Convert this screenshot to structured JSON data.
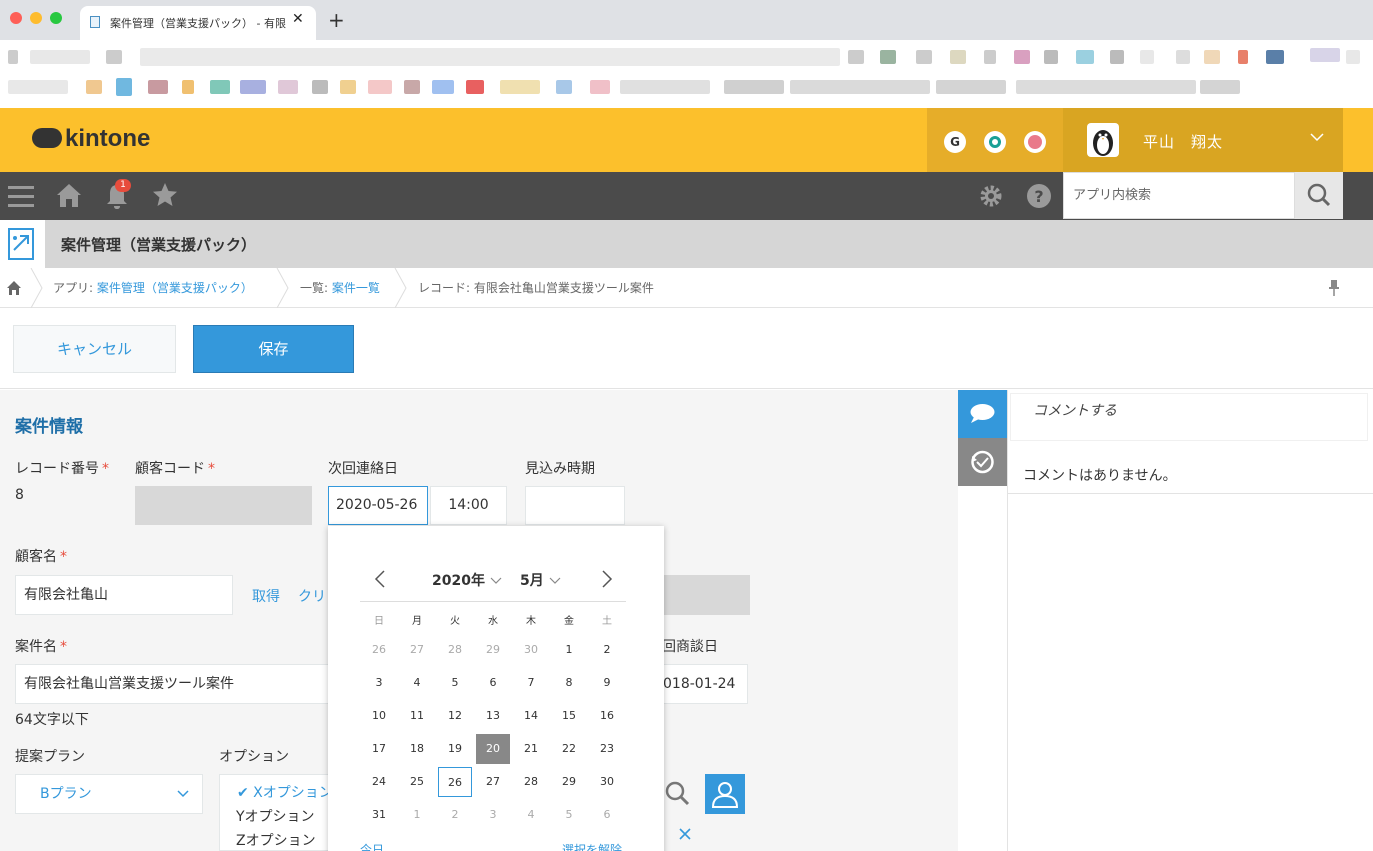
{
  "browser": {
    "tab_title": "案件管理（営業支援パック） - 有限",
    "tab_close": "✕",
    "new_tab": "+"
  },
  "header": {
    "logo_text": "kintone",
    "user_name": "平山　翔太",
    "icon_g": "G"
  },
  "navbar": {
    "notification_count": "1",
    "search_placeholder": "アプリ内検索"
  },
  "app": {
    "title": "案件管理（営業支援パック）"
  },
  "breadcrumb": {
    "app_prefix": "アプリ: ",
    "app_link": "案件管理（営業支援パック）",
    "list_prefix": "一覧: ",
    "list_link": "案件一覧",
    "record_prefix": "レコード: ",
    "record_name": "有限会社亀山営業支援ツール案件"
  },
  "toolbar": {
    "cancel_label": "キャンセル",
    "save_label": "保存"
  },
  "form": {
    "section_title": "案件情報",
    "record_number_label": "レコード番号",
    "record_number_value": "8",
    "customer_code_label": "顧客コード",
    "next_contact_label": "次回連絡日",
    "next_contact_date": "2020-05-26",
    "next_contact_time": "14:00",
    "expected_period_label": "見込み時期",
    "customer_name_label": "顧客名",
    "customer_name_value": "有限会社亀山",
    "fetch_label": "取得",
    "clear_label": "クリ",
    "project_name_label": "案件名",
    "project_name_value": "有限会社亀山営業支援ツール案件",
    "project_name_hint": "64文字以下",
    "last_meeting_label": "回商談日",
    "last_meeting_value": "018-01-24",
    "plan_label": "提案プラン",
    "plan_value": "Bプラン",
    "option_label": "オプション",
    "options": [
      "✔ Xオプション",
      "Yオプション",
      "Zオプション"
    ],
    "required_mark": "*"
  },
  "comments": {
    "input_placeholder": "コメントする",
    "empty_text": "コメントはありません。"
  },
  "datepicker": {
    "year": "2020年",
    "month": "5月",
    "weekdays": [
      "日",
      "月",
      "火",
      "水",
      "木",
      "金",
      "土"
    ],
    "weeks": [
      [
        "26",
        "27",
        "28",
        "29",
        "30",
        "1",
        "2"
      ],
      [
        "3",
        "4",
        "5",
        "6",
        "7",
        "8",
        "9"
      ],
      [
        "10",
        "11",
        "12",
        "13",
        "14",
        "15",
        "16"
      ],
      [
        "17",
        "18",
        "19",
        "20",
        "21",
        "22",
        "23"
      ],
      [
        "24",
        "25",
        "26",
        "27",
        "28",
        "29",
        "30"
      ],
      [
        "31",
        "1",
        "2",
        "3",
        "4",
        "5",
        "6"
      ]
    ],
    "selected_day": "20",
    "focused_day": "26",
    "today_label": "今日",
    "clear_selection_label": "選択を解除"
  },
  "colors": {
    "header_yellow": "#fcc02c",
    "navbar": "#4b4b4b",
    "accent_blue": "#3498db",
    "required_red": "#e74c3c"
  }
}
